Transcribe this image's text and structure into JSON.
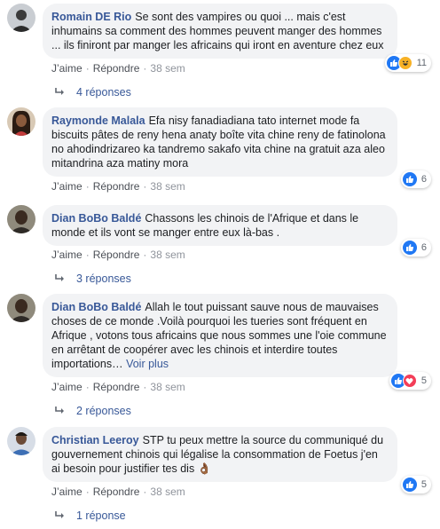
{
  "labels": {
    "like": "J’aime",
    "reply": "Répondre",
    "see_more": "Voir plus"
  },
  "comments": [
    {
      "author": "Romain DE Rio",
      "text": "Se sont des vampires ou quoi ... mais c'est inhumains sa comment des hommes peuvent manger des hommes ... ils finiront par manger les africains qui iront en aventure chez eux",
      "time": "38 sem",
      "reactions": [
        "like-icon",
        "haha-icon"
      ],
      "reaction_count": "11",
      "replies": "4 réponses"
    },
    {
      "author": "Raymonde Malala",
      "text": "Efa nisy fanadiadiana tato internet mode fa biscuits pâtes de reny hena anaty boîte vita chine reny de fatinolona no ahodindrizareo ka tandremo sakafo vita chine na gratuit aza aleo mitandrina aza matiny mora",
      "time": "38 sem",
      "reactions": [
        "like-icon"
      ],
      "reaction_count": "6"
    },
    {
      "author": "Dian BoBo Baldé",
      "text": "Chassons les chinois de l'Afrique et dans le monde et ils vont se manger entre eux là-bas .",
      "time": "38 sem",
      "reactions": [
        "like-icon"
      ],
      "reaction_count": "6",
      "replies": "3 réponses"
    },
    {
      "author": "Dian BoBo Baldé",
      "text": "Allah le tout puissant sauve nous de mauvaises choses de ce monde .Voilà pourquoi les tueries sont fréquent en Afrique , votons tous africains que nous sommes une l'oie commune en arrêtant de coopérer avec les chinois et interdire toutes importations…",
      "time": "38 sem",
      "reactions": [
        "like-icon",
        "love-icon"
      ],
      "reaction_count": "5",
      "replies": "2 réponses"
    },
    {
      "author": "Christian Leeroy",
      "text": "STP tu peux mettre la source du communiqué du gouvernement chinois qui légalise la consommation de Foetus j'en ai besoin pour justifier tes dis 👌🏾",
      "time": "38 sem",
      "reactions": [
        "like-icon"
      ],
      "reaction_count": "5",
      "replies": "1 réponse"
    }
  ]
}
